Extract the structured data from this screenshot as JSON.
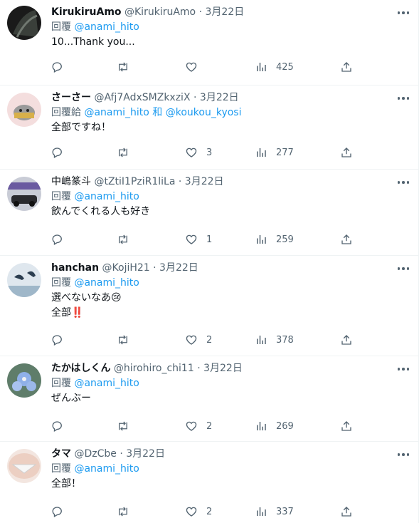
{
  "tweets": [
    {
      "name": "KirukiruAmo",
      "handle": "@KirukiruAmo",
      "date": "3月22日",
      "reply_prefix": "回覆",
      "mentions": "@anami_hito",
      "mention_join": "",
      "mention2": "",
      "lines": [
        "10...Thank you..."
      ],
      "likes": "",
      "views": "425"
    },
    {
      "name": "さーさー",
      "handle": "@Afj7AdxSMZkxziX",
      "date": "3月22日",
      "reply_prefix": "回覆給",
      "mentions": "@anami_hito",
      "mention_join": "和",
      "mention2": "@koukou_kyosi",
      "lines": [
        "全部ですね！"
      ],
      "likes": "3",
      "views": "277"
    },
    {
      "name": "中嶋篆斗",
      "handle": "@tZtiI1PziR1liLa",
      "date": "3月22日",
      "reply_prefix": "回覆",
      "mentions": "@anami_hito",
      "mention_join": "",
      "mention2": "",
      "lines": [
        "飲んでくれる人も好き"
      ],
      "likes": "1",
      "views": "259"
    },
    {
      "name": "hanchan",
      "handle": "@KojiH21",
      "date": "3月22日",
      "reply_prefix": "回覆",
      "mentions": "@anami_hito",
      "mention_join": "",
      "mention2": "",
      "lines": [
        "選べないなあ😢",
        "全部‼️"
      ],
      "likes": "2",
      "views": "378"
    },
    {
      "name": "たかはしくん",
      "handle": "@hirohiro_chi11",
      "date": "3月22日",
      "reply_prefix": "回覆",
      "mentions": "@anami_hito",
      "mention_join": "",
      "mention2": "",
      "lines": [
        "ぜんぶー"
      ],
      "likes": "2",
      "views": "269"
    },
    {
      "name": "タマ",
      "handle": "@DzCbe",
      "date": "3月22日",
      "reply_prefix": "回覆",
      "mentions": "@anami_hito",
      "mention_join": "",
      "mention2": "",
      "lines": [
        "全部！"
      ],
      "likes": "2",
      "views": "337"
    }
  ],
  "separator": "·",
  "colors": {
    "accent": "#1d9bf0",
    "text": "#0f1419",
    "muted": "#536471",
    "border": "#eff3f4"
  },
  "icons": [
    "reply-icon",
    "retweet-icon",
    "like-icon",
    "views-icon",
    "share-icon",
    "more-icon"
  ]
}
